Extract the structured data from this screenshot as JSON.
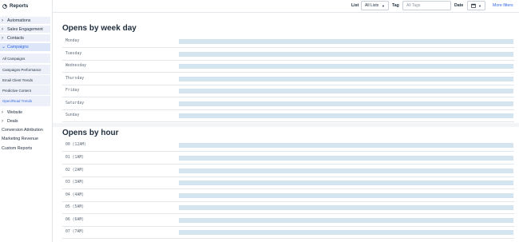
{
  "sidebar": {
    "title": "Reports",
    "collapse_glyph": "«",
    "groups": [
      {
        "label": "Automations",
        "chevron": "›"
      },
      {
        "label": "Sales Engagement",
        "chevron": "›"
      },
      {
        "label": "Contacts",
        "chevron": "›"
      }
    ],
    "campaigns": {
      "label": "Campaigns",
      "chevron": "⌄",
      "items": [
        {
          "label": "All Campaigns"
        },
        {
          "label": "Campaigns Performance"
        },
        {
          "label": "Email Client Trends"
        },
        {
          "label": "Predictive Content"
        },
        {
          "label": "Open/Read Trends"
        }
      ]
    },
    "website": {
      "label": "Website",
      "chevron": "›"
    },
    "deals": {
      "label": "Deals",
      "chevron": "›"
    },
    "plain_items": [
      {
        "label": "Conversion Attribution"
      },
      {
        "label": "Marketing Revenue"
      },
      {
        "label": "Custom Reports"
      }
    ]
  },
  "toolbar": {
    "list_label": "List",
    "list_value": "All Lists",
    "tag_label": "Tag",
    "tag_placeholder": "All Tags",
    "date_label": "Date",
    "more_filters": "More filters"
  },
  "week": {
    "title": "Opens by week day",
    "rows": [
      "Monday",
      "Tuesday",
      "Wednesday",
      "Thursday",
      "Friday",
      "Saturday",
      "Sunday"
    ]
  },
  "hour": {
    "title": "Opens by hour",
    "rows": [
      "00 (12AM)",
      "01 (1AM)",
      "02 (2AM)",
      "03 (3AM)",
      "04 (4AM)",
      "05 (5AM)",
      "06 (6AM)",
      "07 (7AM)"
    ]
  },
  "colors": {
    "accent": "#356ae6",
    "bar": "#d4e5ef",
    "sidebar_group_bg": "#edf0f8"
  }
}
